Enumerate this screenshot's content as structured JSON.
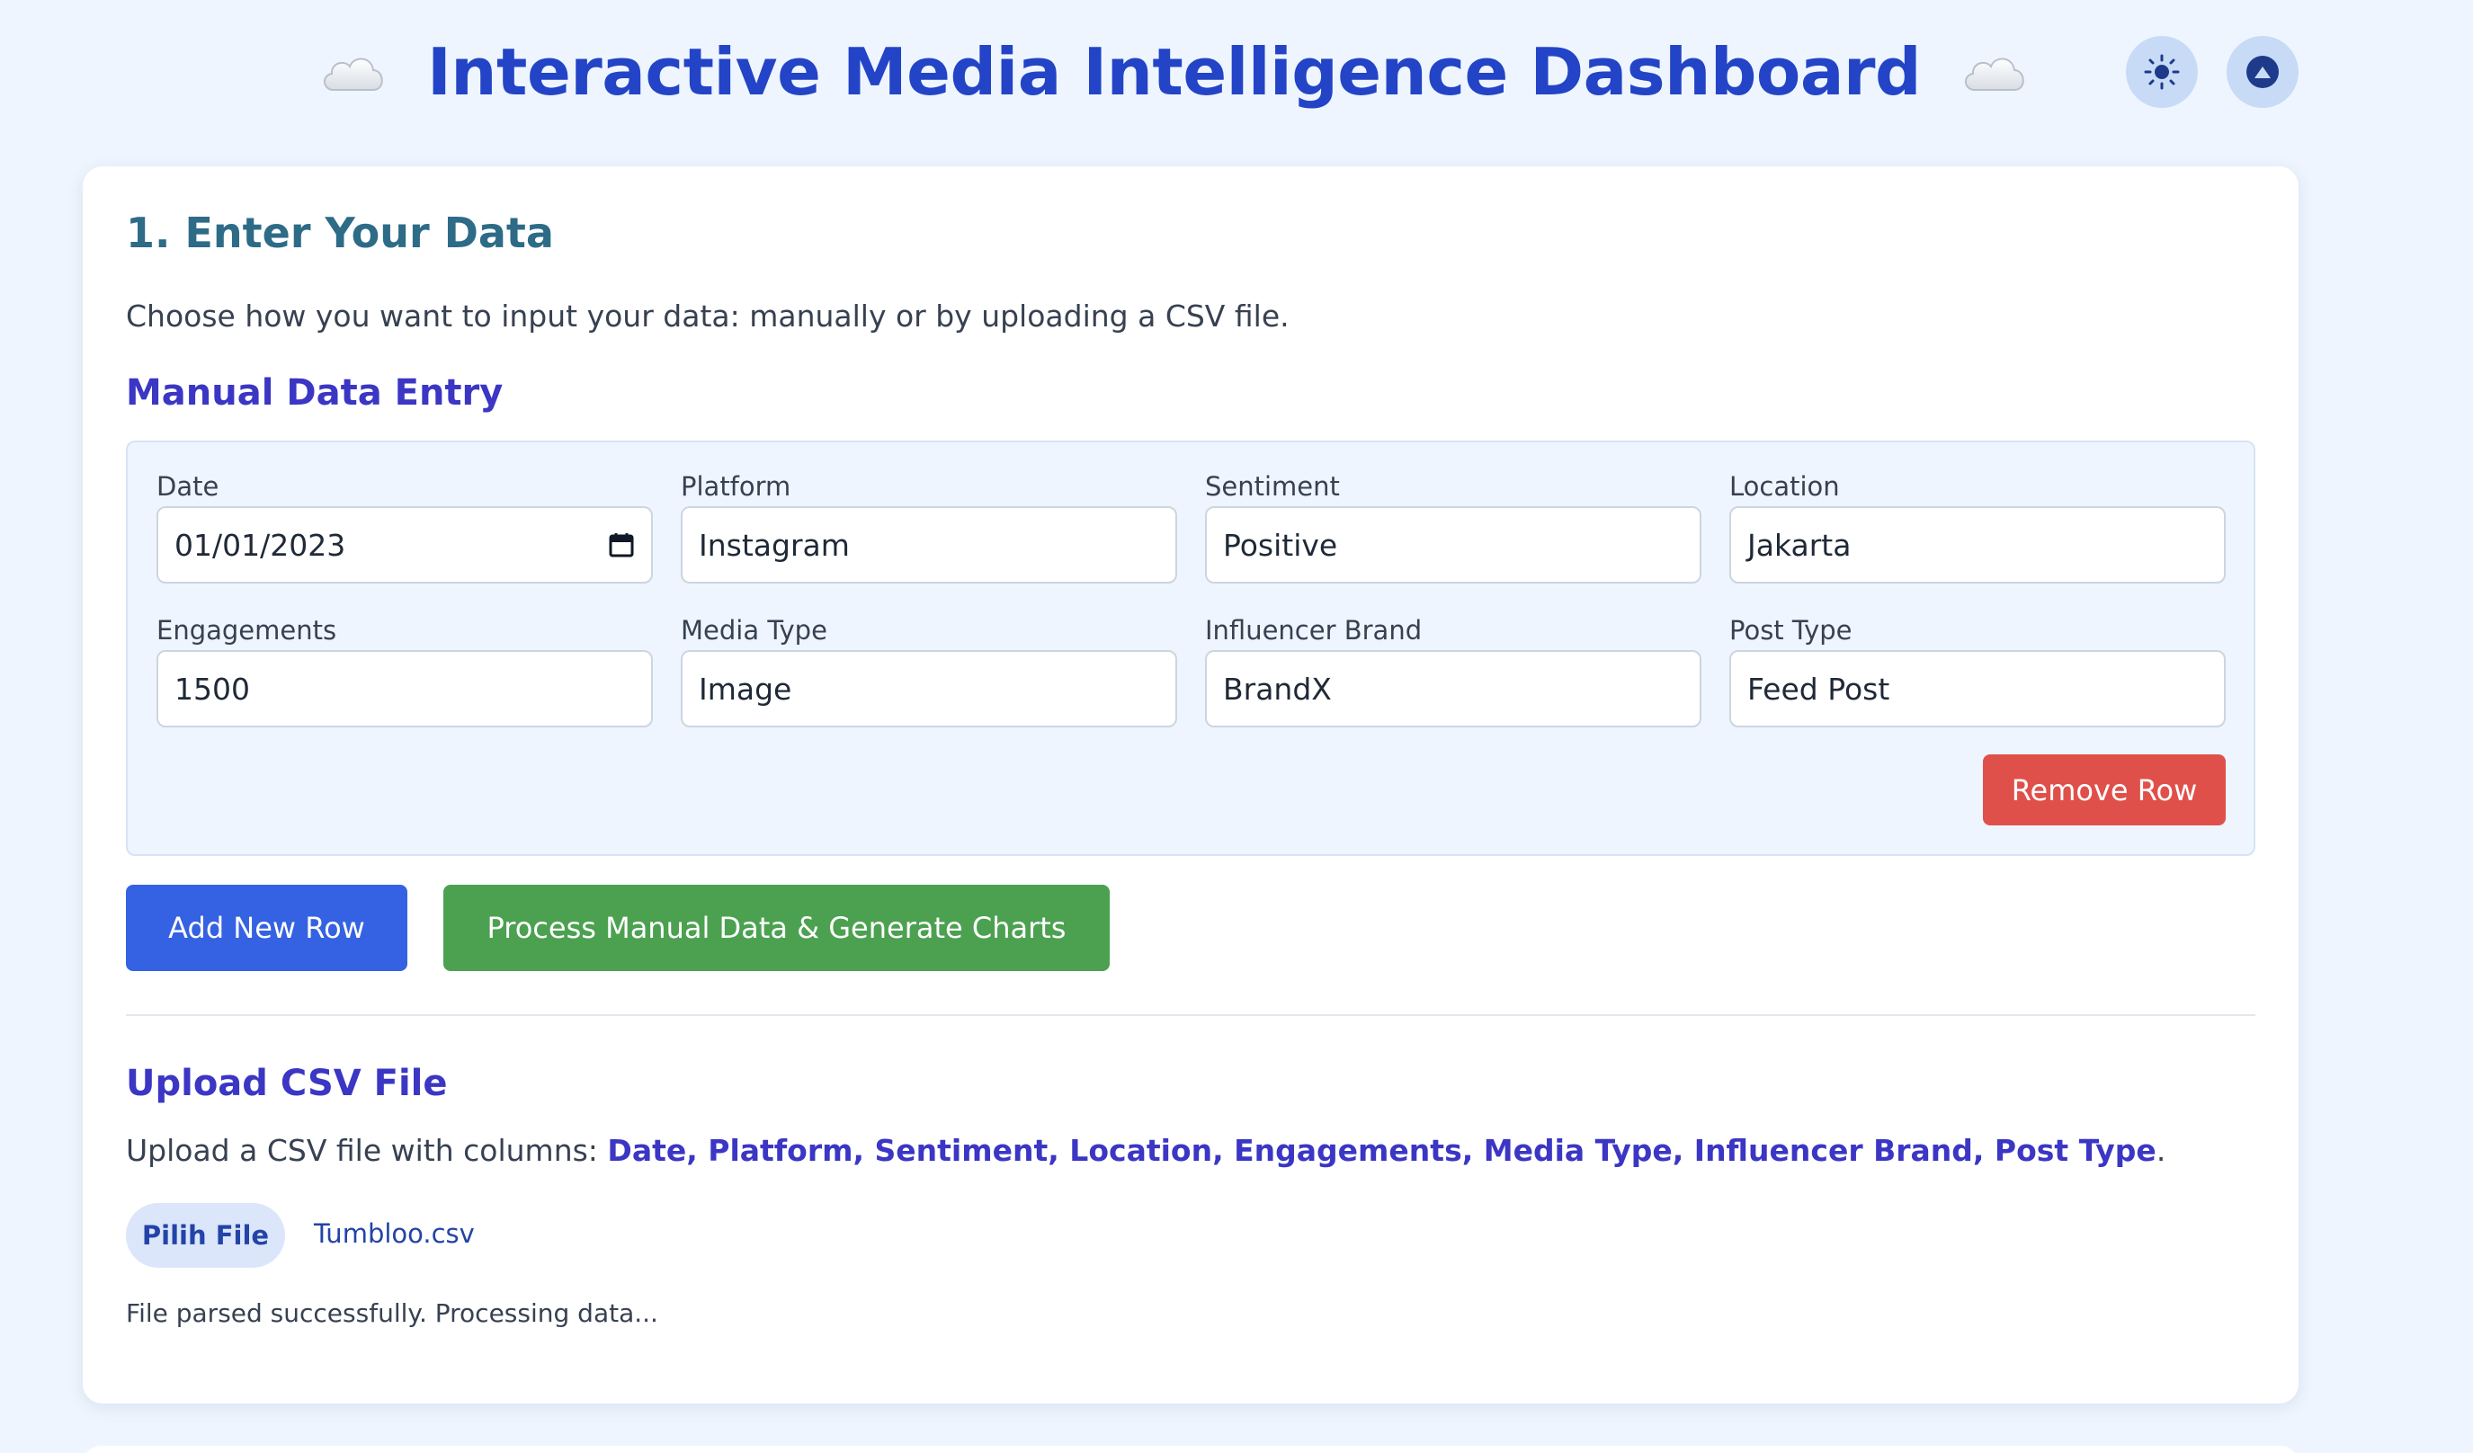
{
  "header": {
    "title": "Interactive Media Intelligence Dashboard",
    "left_icon": "cloud-icon",
    "right_icon": "cloud-icon",
    "theme_button_icon": "sun-icon",
    "profile_button_icon": "user-circle-icon"
  },
  "section": {
    "title": "1. Enter Your Data",
    "intro": "Choose how you want to input your data: manually or by uploading a CSV file."
  },
  "manual": {
    "title": "Manual Data Entry",
    "fields": [
      {
        "label": "Date",
        "value": "01/01/2023"
      },
      {
        "label": "Platform",
        "value": "Instagram"
      },
      {
        "label": "Sentiment",
        "value": "Positive"
      },
      {
        "label": "Location",
        "value": "Jakarta"
      },
      {
        "label": "Engagements",
        "value": "1500"
      },
      {
        "label": "Media Type",
        "value": "Image"
      },
      {
        "label": "Influencer Brand",
        "value": "BrandX"
      },
      {
        "label": "Post Type",
        "value": "Feed Post"
      }
    ],
    "remove_label": "Remove Row",
    "add_label": "Add New Row",
    "process_label": "Process Manual Data & Generate Charts"
  },
  "csv": {
    "title": "Upload CSV File",
    "desc_prefix": "Upload a CSV file with columns: ",
    "columns": "Date, Platform, Sentiment, Location, Engagements, Media Type, Influencer Brand, Post Type",
    "desc_suffix": ".",
    "choose_label": "Pilih File",
    "file_name": "Tumbloo.csv",
    "status": "File parsed successfully. Processing data..."
  },
  "colors": {
    "accent_blue": "#3562e2",
    "title_blue": "#2344c6",
    "success_green": "#4ca151",
    "danger_red": "#e0504a",
    "subtitle_indigo": "#3b36c4",
    "section_teal": "#2d6b87"
  }
}
